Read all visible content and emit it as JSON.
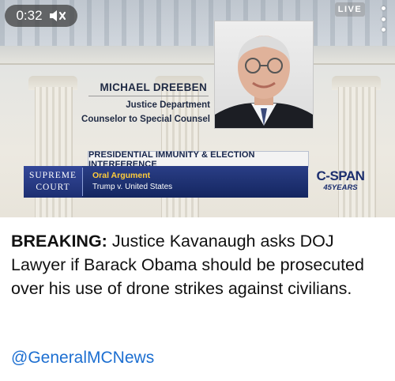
{
  "video": {
    "time": "0:32",
    "mute_icon": "speaker-muted-icon",
    "live_label": "LIVE",
    "more_icon": "more-vertical-icon",
    "nameplate": {
      "name": "MICHAEL DREEBEN",
      "title_line1": "Justice Department",
      "title_line2": "Counselor to Special Counsel"
    },
    "topic": "PRESIDENTIAL IMMUNITY & ELECTION INTERFERENCE",
    "court_line1": "SUPREME",
    "court_line2": "COURT",
    "event": "Oral Argument",
    "case": "Trump v. United States",
    "network_logo": "C-SPAN",
    "network_years": "45YEARS"
  },
  "post": {
    "breaking_label": "BREAKING:",
    "headline": " Justice Kavanaugh asks DOJ Lawyer if Barack Obama should be prosecuted over his use of drone strikes against civilians.",
    "handle": "@GeneralMCNews"
  },
  "colors": {
    "lower_third": "#1d2f72",
    "event_text": "#ffcc3a",
    "handle_link": "#1d6fd1",
    "nameplate_text": "#1f2a44"
  }
}
